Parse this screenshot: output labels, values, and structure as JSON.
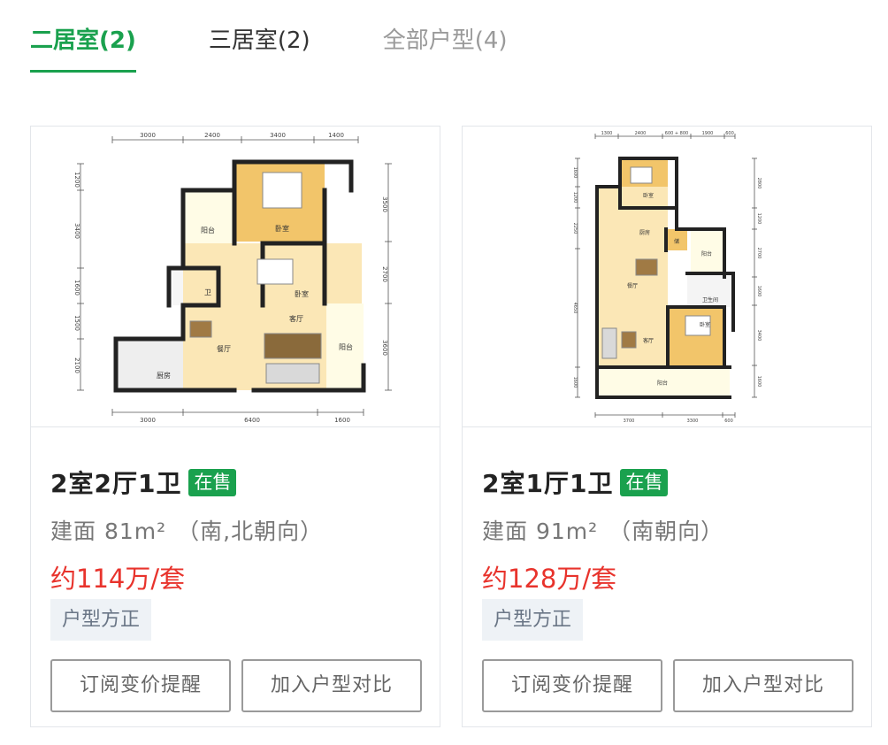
{
  "tabs": [
    {
      "label": "二居室(2)",
      "active": true
    },
    {
      "label": "三居室(2)",
      "active": false
    },
    {
      "label": "全部户型(4)",
      "active": false
    }
  ],
  "cards": [
    {
      "title": "2室2厅1卫",
      "status": "在售",
      "area": "建面 81m²",
      "orientation": "（南,北朝向）",
      "price": "约114万/套",
      "tag": "户型方正",
      "buttons": [
        "订阅变价提醒",
        "加入户型对比"
      ],
      "plan": {
        "dims_top": [
          "3000",
          "2400",
          "3400",
          "1400"
        ],
        "dims_bottom": [
          "3000",
          "6400",
          "1600"
        ],
        "dims_left": [
          "1200",
          "3400",
          "1600",
          "1500",
          "2100"
        ],
        "dims_right": [
          "3500",
          "2700",
          "3600"
        ],
        "rooms": {
          "balcony_1": "阳台",
          "bedroom_1": "卧室",
          "bedroom_2": "卧室",
          "bathroom": "卫",
          "living": "客厅",
          "dining": "餐厅",
          "balcony_2": "阳台",
          "kitchen": "厨房"
        }
      }
    },
    {
      "title": "2室1厅1卫",
      "status": "在售",
      "area": "建面 91m²",
      "orientation": "（南朝向）",
      "price": "约128万/套",
      "tag": "户型方正",
      "buttons": [
        "订阅变价提醒",
        "加入户型对比"
      ],
      "plan": {
        "dims_top": [
          "1300",
          "2400",
          "600 + 800",
          "1900",
          "600"
        ],
        "dims_bottom": [
          "3700",
          "3300",
          "600"
        ],
        "dims_left": [
          "1600",
          "1200",
          "2250",
          "4650",
          "1600"
        ],
        "dims_right": [
          "2800",
          "1200",
          "2700",
          "1600",
          "3400",
          "1600"
        ],
        "rooms": {
          "bedroom_1": "卧室",
          "kitchen": "厨房",
          "storage": "储",
          "balcony_1": "阳台",
          "dining": "餐厅",
          "bathroom": "卫生间",
          "living": "客厅",
          "bedroom_2": "卧室",
          "balcony_2": "阳台"
        }
      }
    }
  ]
}
